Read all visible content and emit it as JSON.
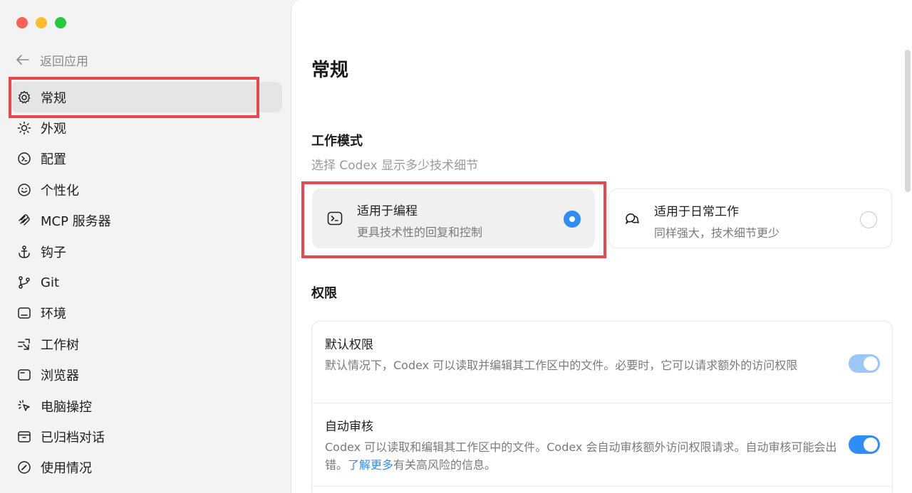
{
  "sidebar": {
    "back_label": "返回应用",
    "items": [
      {
        "label": "常规",
        "icon": "gear-icon"
      },
      {
        "label": "外观",
        "icon": "sun-icon"
      },
      {
        "label": "配置",
        "icon": "config-icon"
      },
      {
        "label": "个性化",
        "icon": "smile-icon"
      },
      {
        "label": "MCP 服务器",
        "icon": "mcp-icon"
      },
      {
        "label": "钩子",
        "icon": "anchor-icon"
      },
      {
        "label": "Git",
        "icon": "git-branch-icon"
      },
      {
        "label": "环境",
        "icon": "environment-icon"
      },
      {
        "label": "工作树",
        "icon": "worktree-icon"
      },
      {
        "label": "浏览器",
        "icon": "browser-icon"
      },
      {
        "label": "电脑操控",
        "icon": "cursor-icon"
      },
      {
        "label": "已归档对话",
        "icon": "archive-icon"
      },
      {
        "label": "使用情况",
        "icon": "gauge-icon"
      }
    ]
  },
  "main": {
    "title": "常规",
    "work_mode": {
      "title": "工作模式",
      "subtitle": "选择 Codex 显示多少技术细节",
      "options": [
        {
          "title": "适用于编程",
          "desc": "更具技术性的回复和控制",
          "selected": true
        },
        {
          "title": "适用于日常工作",
          "desc": "同样强大，技术细节更少",
          "selected": false
        }
      ]
    },
    "permissions": {
      "title": "权限",
      "rows": [
        {
          "title": "默认权限",
          "desc": "默认情况下，Codex 可以读取并编辑其工作区中的文件。必要时，它可以请求额外的访问权限",
          "enabled": true
        },
        {
          "title": "自动审核",
          "desc_before": "Codex 可以读取和编辑其工作区中的文件。Codex 会自动审核额外访问权限请求。自动审核可能会出错。",
          "link": "了解更多",
          "desc_after": "有关高风险的信息。",
          "enabled": true
        }
      ]
    }
  },
  "colors": {
    "accent": "#2f8ef5",
    "highlight": "#e8474e",
    "close": "#fe5f57",
    "minimize": "#febc2e",
    "zoom": "#28c840"
  }
}
